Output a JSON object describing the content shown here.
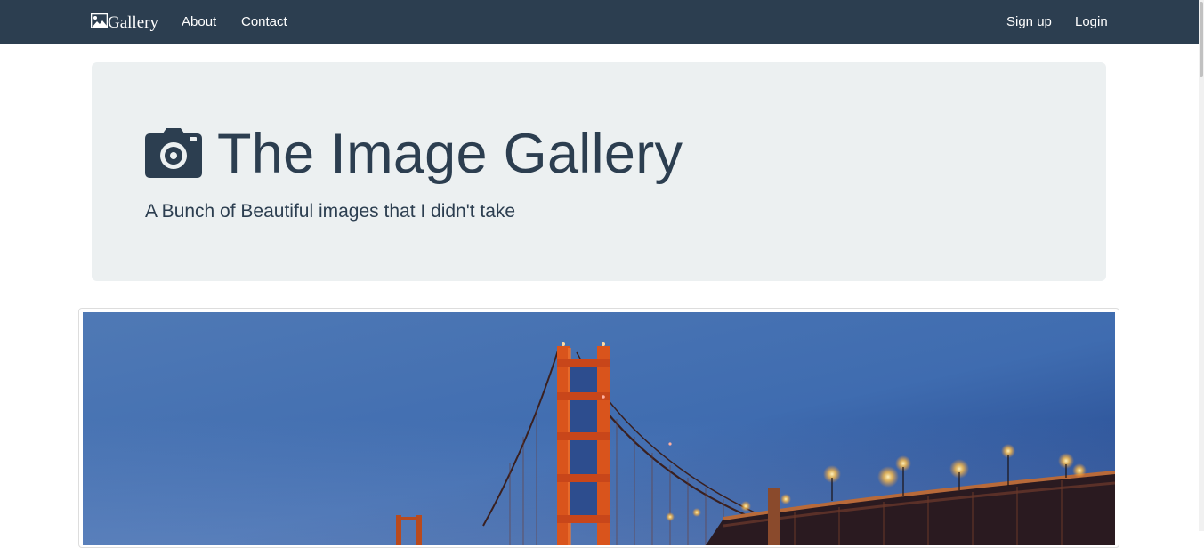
{
  "navbar": {
    "brand_label": "Gallery",
    "brand_icon": "image-icon",
    "links_left": [
      "About",
      "Contact"
    ],
    "links_right": [
      "Sign up",
      "Login"
    ],
    "background": "#2c3e50"
  },
  "hero": {
    "icon": "camera-icon",
    "title": "The Image Gallery",
    "subtitle": "A Bunch of Beautiful images that I didn't take",
    "background": "#ecf0f1"
  },
  "gallery": {
    "image_subject": "golden-gate-bridge-at-dusk",
    "accent": "#c84a1a"
  }
}
